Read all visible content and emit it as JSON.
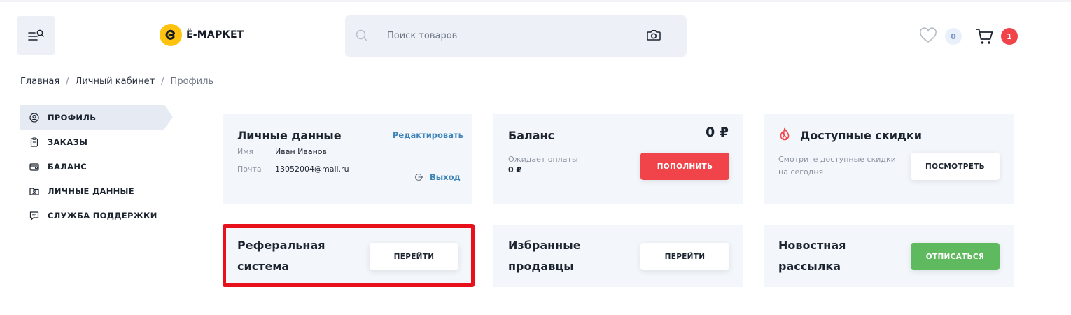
{
  "header": {
    "logo_text": "Ё-МАРКЕТ",
    "search_placeholder": "Поиск товаров",
    "favorites_count": "0",
    "cart_count": "1"
  },
  "breadcrumb": {
    "items": [
      "Главная",
      "Личный кабинет",
      "Профиль"
    ]
  },
  "sidebar": {
    "items": [
      {
        "label": "ПРОФИЛЬ",
        "icon": "user-circle-icon",
        "active": true
      },
      {
        "label": "ЗАКАЗЫ",
        "icon": "clipboard-icon"
      },
      {
        "label": "БАЛАНС",
        "icon": "wallet-icon"
      },
      {
        "label": "ЛИЧНЫЕ ДАННЫЕ",
        "icon": "folder-user-icon"
      },
      {
        "label": "СЛУЖБА ПОДДЕРЖКИ",
        "icon": "chat-icon"
      }
    ]
  },
  "personal": {
    "title": "Личные данные",
    "edit": "Редактировать",
    "name_label": "Имя",
    "name_value": "Иван Иванов",
    "email_label": "Почта",
    "email_value": "13052004@mail.ru",
    "logout": "Выход"
  },
  "balance": {
    "title": "Баланс",
    "amount": "0 ₽",
    "pending_label": "Ожидает оплаты",
    "pending_value": "0 ₽",
    "button": "ПОПОЛНИТЬ"
  },
  "discounts": {
    "title": "Доступные скидки",
    "text_line1": "Смотрите доступные скидки",
    "text_line2": "на сегодня",
    "button": "ПОСМОТРЕТЬ"
  },
  "referral": {
    "title_line1": "Реферальная",
    "title_line2": "система",
    "button": "ПЕРЕЙТИ"
  },
  "sellers": {
    "title_line1": "Избранные",
    "title_line2": "продавцы",
    "button": "ПЕРЕЙТИ"
  },
  "newsletter": {
    "title_line1": "Новостная",
    "title_line2": "рассылка",
    "button": "ОТПИСАТЬСЯ"
  },
  "colors": {
    "accent_red": "#f0434a",
    "accent_green": "#5fb95f",
    "link_blue": "#3e84b8",
    "logo_yellow": "#ffc20e",
    "highlight": "#e8101a"
  }
}
